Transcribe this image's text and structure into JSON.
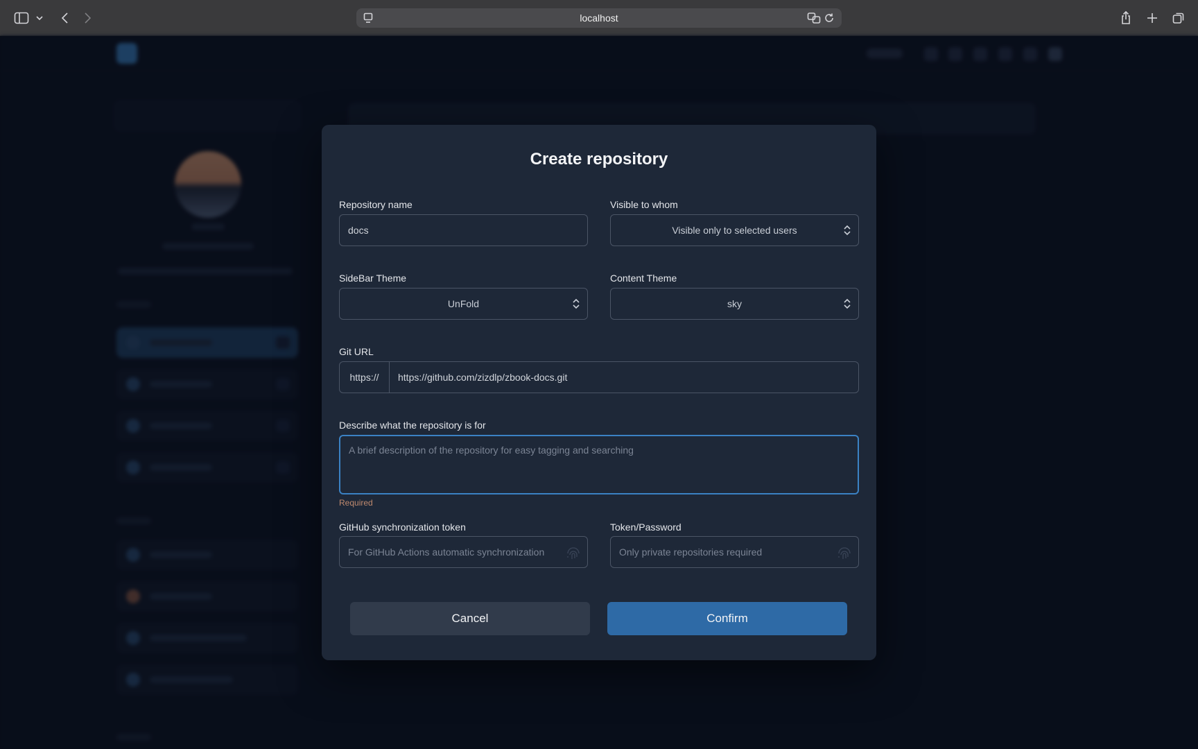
{
  "browser": {
    "url": "localhost"
  },
  "modal": {
    "title": "Create repository",
    "repo_name": {
      "label": "Repository name",
      "value": "docs"
    },
    "visibility": {
      "label": "Visible to whom",
      "value": "Visible only to selected users"
    },
    "sidebar_theme": {
      "label": "SideBar Theme",
      "value": "UnFold"
    },
    "content_theme": {
      "label": "Content Theme",
      "value": "sky"
    },
    "git_url": {
      "label": "Git URL",
      "prefix": "https://",
      "value": "https://github.com/zizdlp/zbook-docs.git"
    },
    "description": {
      "label": "Describe what the repository is for",
      "placeholder": "A brief description of the repository for easy tagging and searching",
      "error": "Required"
    },
    "sync_token": {
      "label": "GitHub synchronization token",
      "placeholder": "For GitHub Actions automatic synchronization"
    },
    "token_password": {
      "label": "Token/Password",
      "placeholder": "Only private repositories required"
    },
    "cancel_label": "Cancel",
    "confirm_label": "Confirm"
  },
  "colors": {
    "accent": "#2e6aa6",
    "focus_border": "#3b82c4",
    "error_text": "#c08a6e",
    "modal_bg": "#1e2838"
  }
}
